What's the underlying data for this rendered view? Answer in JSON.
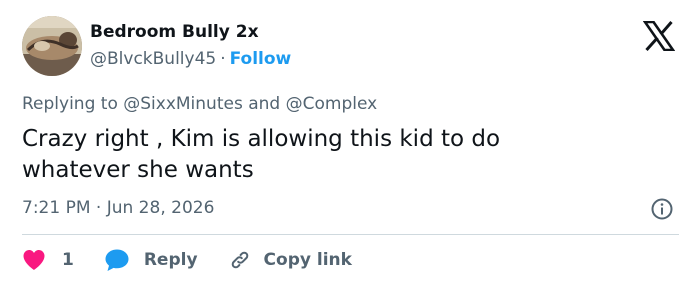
{
  "author": {
    "display_name": "Bedroom Bully 2x",
    "handle": "@BlvckBully45",
    "separator": "·",
    "follow_label": "Follow"
  },
  "reply_context": {
    "prefix": "Replying to",
    "mention_1": "@SixxMinutes",
    "conjunction": "and",
    "mention_2": "@Complex"
  },
  "tweet": {
    "line_1": "Crazy right , Kim is allowing this kid to do",
    "line_2": "whatever she wants"
  },
  "meta": {
    "time": "7:21 PM",
    "separator": "·",
    "date": "Jun 28, 2026"
  },
  "actions": {
    "like_count": "1",
    "reply_label": "Reply",
    "copy_link_label": "Copy link"
  },
  "colors": {
    "text_primary": "#0f1419",
    "text_secondary": "#536471",
    "link_blue": "#1d9bf0",
    "like_red": "#f91880",
    "divider": "#cfd9de"
  },
  "icons": [
    "x-logo-icon",
    "info-icon",
    "heart-icon",
    "reply-bubble-icon",
    "link-icon"
  ]
}
